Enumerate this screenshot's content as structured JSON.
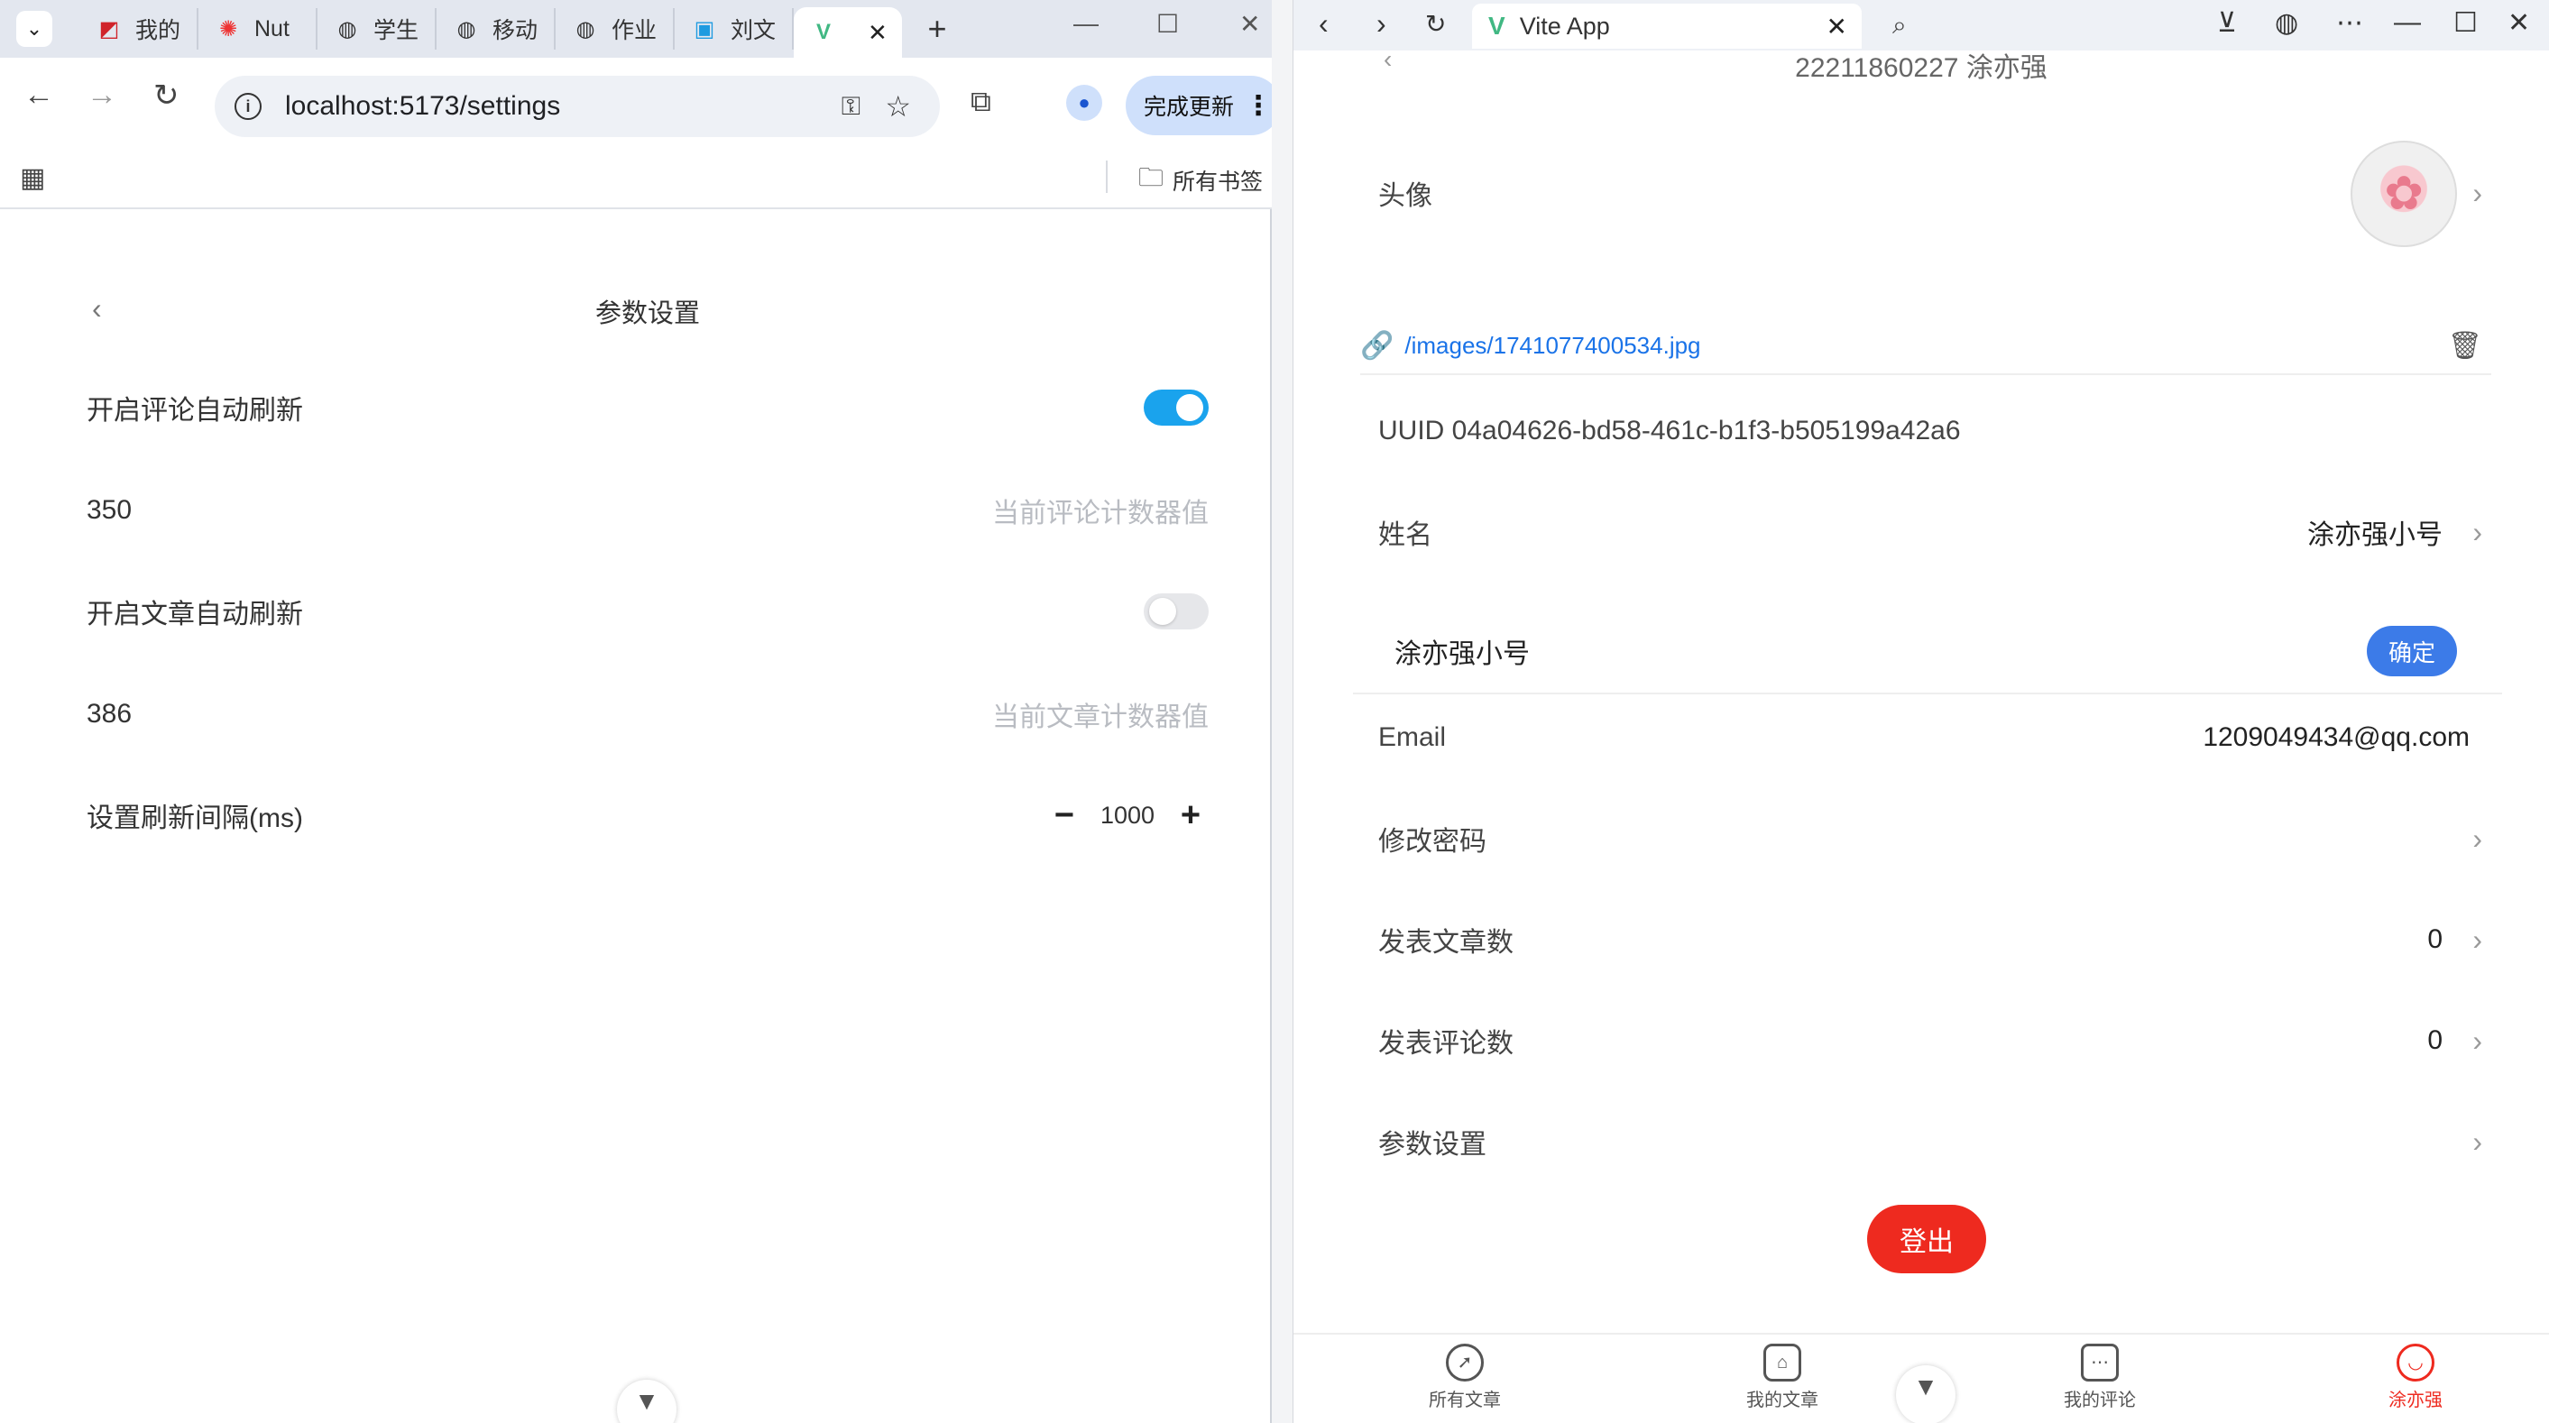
{
  "left_window": {
    "tabs": [
      {
        "label": "我的",
        "icon": "cnki-icon"
      },
      {
        "label": "Nut",
        "icon": "sun-icon"
      },
      {
        "label": "学生",
        "icon": "globe-icon"
      },
      {
        "label": "移动",
        "icon": "globe-icon"
      },
      {
        "label": "作业",
        "icon": "globe-icon"
      },
      {
        "label": "刘文",
        "icon": "bilibili-icon"
      }
    ],
    "url": "localhost:5173/settings",
    "update_label": "完成更新",
    "bookmarks_label": "所有书签"
  },
  "settings": {
    "title": "参数设置",
    "comment_refresh_label": "开启评论自动刷新",
    "comment_refresh_on": true,
    "comment_counter_value": "350",
    "comment_counter_hint": "当前评论计数器值",
    "article_refresh_label": "开启文章自动刷新",
    "article_refresh_on": false,
    "article_counter_value": "386",
    "article_counter_hint": "当前文章计数器值",
    "interval_label": "设置刷新间隔(ms)",
    "interval_value": "1000"
  },
  "right_window": {
    "tab_title": "Vite App"
  },
  "profile": {
    "header": "22211860227 涂亦强",
    "avatar_label": "头像",
    "avatar_link": "/images/1741077400534.jpg",
    "uuid": "UUID 04a04626-bd58-461c-b1f3-b505199a42a6",
    "name_label": "姓名",
    "name_value": "涂亦强小号",
    "name_input_value": "涂亦强小号",
    "confirm_label": "确定",
    "email_label": "Email",
    "email_value": "1209049434@qq.com",
    "change_password_label": "修改密码",
    "articles_label": "发表文章数",
    "articles_value": "0",
    "comments_label": "发表评论数",
    "comments_value": "0",
    "settings_label": "参数设置",
    "logout_label": "登出"
  },
  "tabbar": [
    {
      "label": "所有文章"
    },
    {
      "label": "我的文章"
    },
    {
      "label": "我的评论"
    },
    {
      "label": "涂亦强"
    }
  ],
  "colors": {
    "toggle_on": "#1aa3ed",
    "confirm_button": "#3c7be8",
    "logout_button": "#ee2a1f",
    "active_tab": "#ee2a1f",
    "link": "#1a73e8"
  }
}
